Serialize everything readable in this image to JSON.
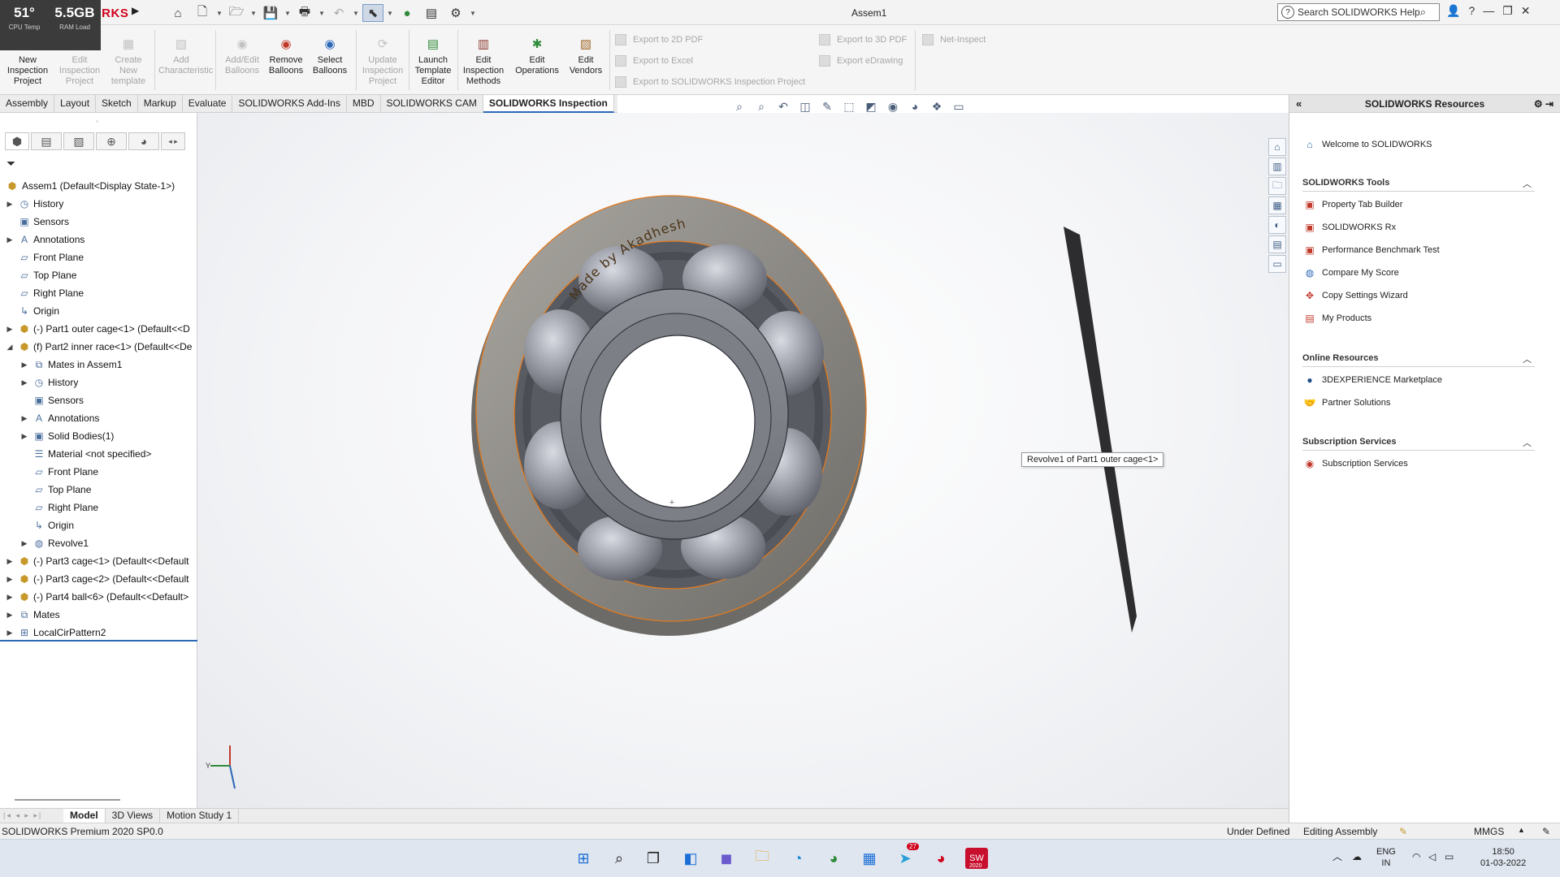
{
  "hud": {
    "cpu_value": "51°",
    "cpu_label": "CPU Temp",
    "ram_value": "5.5GB",
    "ram_label": "RAM Load"
  },
  "app": {
    "logo": "SOLIDWORKS",
    "window_title": "Assem1"
  },
  "search": {
    "placeholder": "Search SOLIDWORKS Help"
  },
  "quick_access": [
    "home-icon",
    "new-icon",
    "open-icon",
    "save-icon",
    "print-icon",
    "undo-icon",
    "select-icon",
    "rebuild-icon",
    "file-properties-icon",
    "options-icon"
  ],
  "ribbon": {
    "buttons": [
      {
        "label": "New Inspection Project",
        "enabled": true
      },
      {
        "label": "Edit Inspection Project",
        "enabled": false
      },
      {
        "label": "Create New template",
        "enabled": false
      },
      {
        "label": "Add Characteristic",
        "enabled": false
      },
      {
        "label": "Add/Edit Balloons",
        "enabled": false
      },
      {
        "label": "Remove Balloons",
        "enabled": true
      },
      {
        "label": "Select Balloons",
        "enabled": true
      },
      {
        "label": "Update Inspection Project",
        "enabled": false
      },
      {
        "label": "Launch Template Editor",
        "enabled": true
      },
      {
        "label": "Edit Inspection Methods",
        "enabled": true
      },
      {
        "label": "Edit Operations",
        "enabled": true
      },
      {
        "label": "Edit Vendors",
        "enabled": true
      }
    ],
    "exports": {
      "to_2d_pdf": "Export to 2D PDF",
      "to_excel": "Export to Excel",
      "to_project": "Export to SOLIDWORKS Inspection Project",
      "to_3d_pdf": "Export to 3D PDF",
      "edrawing": "Export eDrawing",
      "net_inspect": "Net-Inspect"
    }
  },
  "command_tabs": [
    "Assembly",
    "Layout",
    "Sketch",
    "Markup",
    "Evaluate",
    "SOLIDWORKS Add-Ins",
    "MBD",
    "SOLIDWORKS CAM",
    "SOLIDWORKS Inspection"
  ],
  "active_command_tab": "SOLIDWORKS Inspection",
  "tree": {
    "root": "Assem1  (Default<Display State-1>)",
    "items": [
      {
        "label": "History"
      },
      {
        "label": "Sensors"
      },
      {
        "label": "Annotations"
      },
      {
        "label": "Front Plane"
      },
      {
        "label": "Top Plane"
      },
      {
        "label": "Right Plane"
      },
      {
        "label": "Origin"
      },
      {
        "label": "(-) Part1 outer cage<1> (Default<<D"
      },
      {
        "label": "(f) Part2 inner race<1> (Default<<De"
      },
      {
        "label": "Mates in Assem1"
      },
      {
        "label": "History"
      },
      {
        "label": "Sensors"
      },
      {
        "label": "Annotations"
      },
      {
        "label": "Solid Bodies(1)"
      },
      {
        "label": "Material <not specified>"
      },
      {
        "label": "Front Plane"
      },
      {
        "label": "Top Plane"
      },
      {
        "label": "Right Plane"
      },
      {
        "label": "Origin"
      },
      {
        "label": "Revolve1"
      },
      {
        "label": "(-) Part3 cage<1> (Default<<Default"
      },
      {
        "label": "(-) Part3 cage<2> (Default<<Default"
      },
      {
        "label": "(-) Part4 ball<6> (Default<<Default>"
      },
      {
        "label": "Mates"
      },
      {
        "label": "LocalCirPattern2"
      }
    ]
  },
  "bottom_tabs": [
    "Model",
    "3D Views",
    "Motion Study 1"
  ],
  "active_bottom_tab": "Model",
  "viewport": {
    "engraving": "Made by Akadhesh",
    "tooltip": "Revolve1 of Part1 outer cage<1>"
  },
  "status": {
    "product": "SOLIDWORKS Premium 2020 SP0.0",
    "state": "Under Defined",
    "mode": "Editing Assembly",
    "units": "MMGS"
  },
  "task_pane": {
    "title": "SOLIDWORKS Resources",
    "welcome": "Welcome to SOLIDWORKS",
    "sections": [
      {
        "title": "SOLIDWORKS Tools",
        "items": [
          "Property Tab Builder",
          "SOLIDWORKS Rx",
          "Performance Benchmark Test",
          "Compare My Score",
          "Copy Settings Wizard",
          "My Products"
        ]
      },
      {
        "title": "Online Resources",
        "items": [
          "3DEXPERIENCE Marketplace",
          "Partner Solutions"
        ]
      },
      {
        "title": "Subscription Services",
        "items": [
          "Subscription Services"
        ]
      }
    ]
  },
  "taskbar": {
    "lang": "ENG",
    "region": "IN",
    "time": "18:50",
    "date": "01-03-2022",
    "badge": "27",
    "sw_badge": "2020",
    "icons": [
      "windows-start-icon",
      "search-icon",
      "task-view-icon",
      "widgets-icon",
      "teams-chat-icon",
      "file-explorer-icon",
      "edge-icon",
      "chrome-icon",
      "store-icon",
      "telegram-icon",
      "chrome-profile-icon",
      "solidworks-icon"
    ]
  },
  "colors": {
    "accent": "#2b68b6",
    "brand": "#d0021b",
    "part_edge": "#e07a1f",
    "part_body": "#8b8b90"
  }
}
